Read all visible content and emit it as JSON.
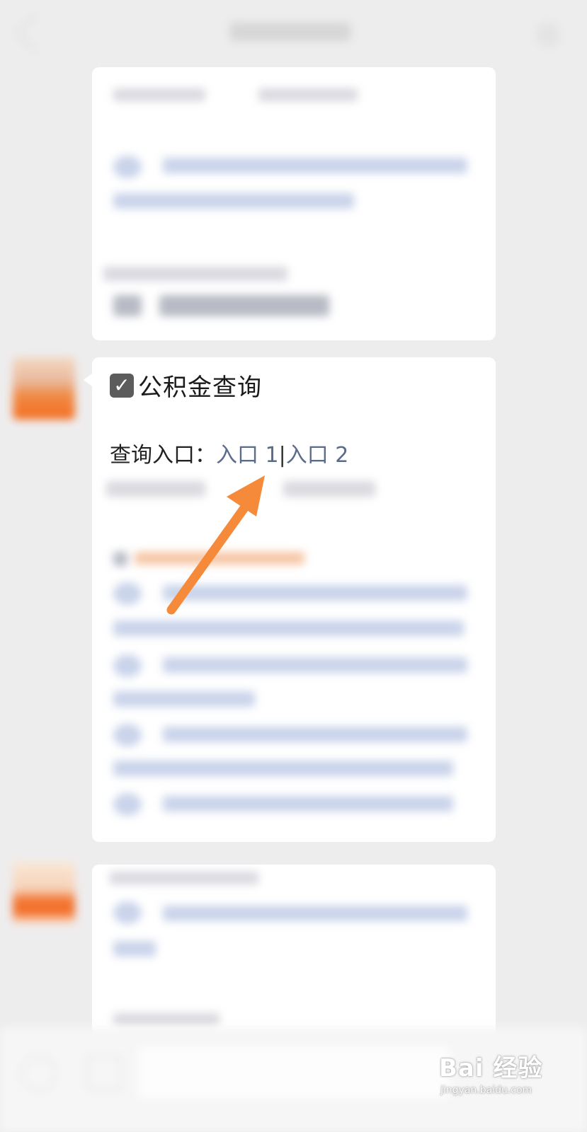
{
  "message": {
    "heading": "公积金查询",
    "entry_label": "查询入口：",
    "entry_link_1": "入口 1",
    "entry_separator": "|",
    "entry_link_2": "入口 2"
  },
  "icons": {
    "checkbox": "checkbox-checked-icon",
    "arrow": "orange-arrow-annotation"
  },
  "colors": {
    "link": "#5b6b8c",
    "arrow": "#f58a3a",
    "card": "#ffffff",
    "background": "#eeedee"
  },
  "watermark": {
    "logo": "Bai 经验",
    "url": "jingyan.baidu.com"
  }
}
